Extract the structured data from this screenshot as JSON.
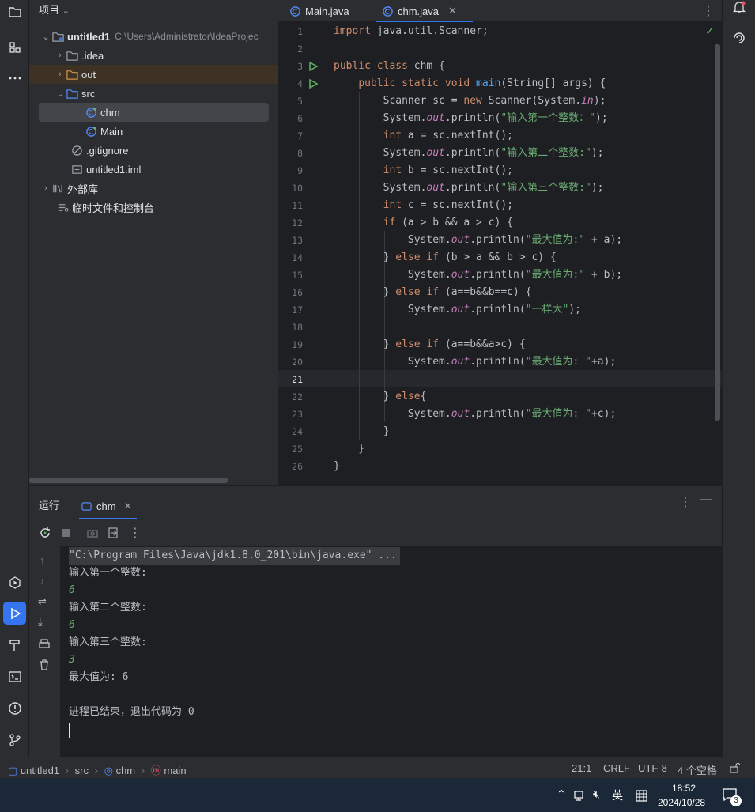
{
  "project": {
    "title": "项目",
    "tree": [
      {
        "label": "untitled1",
        "path": "C:\\Users\\Administrator\\IdeaProjec",
        "icon": "module-folder-icon",
        "arrow": "expanded"
      },
      {
        "label": ".idea",
        "icon": "folder-icon",
        "arrow": "collapsed"
      },
      {
        "label": "out",
        "icon": "folder-orange-icon",
        "arrow": "collapsed"
      },
      {
        "label": "src",
        "icon": "source-folder-icon",
        "arrow": "expanded"
      },
      {
        "label": "chm",
        "icon": "java-class-icon",
        "arrow": "none"
      },
      {
        "label": "Main",
        "icon": "java-class-icon",
        "arrow": "none"
      },
      {
        "label": ".gitignore",
        "icon": "ignore-file-icon",
        "arrow": "none"
      },
      {
        "label": "untitled1.iml",
        "icon": "iml-file-icon",
        "arrow": "none"
      },
      {
        "label": "外部库",
        "icon": "library-icon",
        "arrow": "collapsed"
      },
      {
        "label": "临时文件和控制台",
        "icon": "scratches-icon",
        "arrow": "none"
      }
    ]
  },
  "editor": {
    "tabs": [
      {
        "label": "Main.java",
        "active": false
      },
      {
        "label": "chm.java",
        "active": true
      }
    ],
    "current_line": "21",
    "line_numbers": [
      "1",
      "2",
      "3",
      "4",
      "5",
      "6",
      "7",
      "8",
      "9",
      "10",
      "11",
      "12",
      "13",
      "14",
      "15",
      "16",
      "17",
      "18",
      "19",
      "20",
      "21",
      "22",
      "23",
      "24",
      "25",
      "26"
    ]
  },
  "run": {
    "title": "运行",
    "tab": "chm",
    "console": [
      {
        "text": "\"C:\\Program Files\\Java\\jdk1.8.0_201\\bin\\java.exe\" ...",
        "kind": "cmd"
      },
      {
        "text": "输入第一个整数:",
        "kind": "out"
      },
      {
        "text": "6",
        "kind": "inp"
      },
      {
        "text": "输入第二个整数:",
        "kind": "out"
      },
      {
        "text": "6",
        "kind": "inp"
      },
      {
        "text": "输入第三个整数:",
        "kind": "out"
      },
      {
        "text": "3",
        "kind": "inp"
      },
      {
        "text": "最大值为: 6",
        "kind": "out"
      },
      {
        "text": "",
        "kind": "out"
      },
      {
        "text": "进程已结束，退出代码为 0",
        "kind": "out"
      }
    ]
  },
  "status": {
    "crumb_project": "untitled1",
    "crumb_src": "src",
    "crumb_class": "chm",
    "crumb_method": "main",
    "position": "21:1",
    "line_sep": "CRLF",
    "encoding": "UTF-8",
    "indent": "4 个空格"
  },
  "taskbar": {
    "ime": "英",
    "time": "18:52",
    "date": "2024/10/28",
    "notifications": "3"
  },
  "colors": {
    "accent": "#3574f0",
    "keyword": "#cf8e6d",
    "string": "#6aab73",
    "function": "#56a8f5",
    "field": "#c77dbb"
  }
}
